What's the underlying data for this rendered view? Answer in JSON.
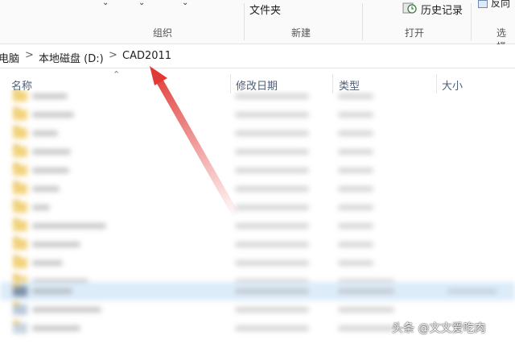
{
  "ribbon": {
    "items": {
      "new_folder_hint": "文件夹",
      "history": "历史记录",
      "reverse_select": "反向"
    },
    "groups": {
      "organize": "组织",
      "new": "新建",
      "open": "打开",
      "select": "选择"
    }
  },
  "address": {
    "crumbs": [
      "电脑",
      "本地磁盘 (D:)",
      "CAD2011"
    ],
    "separator": ">"
  },
  "columns": {
    "name": "名称",
    "modified": "修改日期",
    "type": "类型",
    "size": "大小"
  },
  "watermark": {
    "text": "头条 @文文爱吃肉"
  },
  "colors": {
    "arrow": "#e03a36",
    "selected_row": "#dcecf9",
    "folder": "#f2d27a",
    "column_header_text": "#4c607a"
  },
  "icons": {
    "history": "history-icon",
    "recycle": "bin-icon",
    "breadcrumb_separator": "chevron-right-icon",
    "sort": "sort-caret-icon",
    "folder": "folder-icon"
  }
}
